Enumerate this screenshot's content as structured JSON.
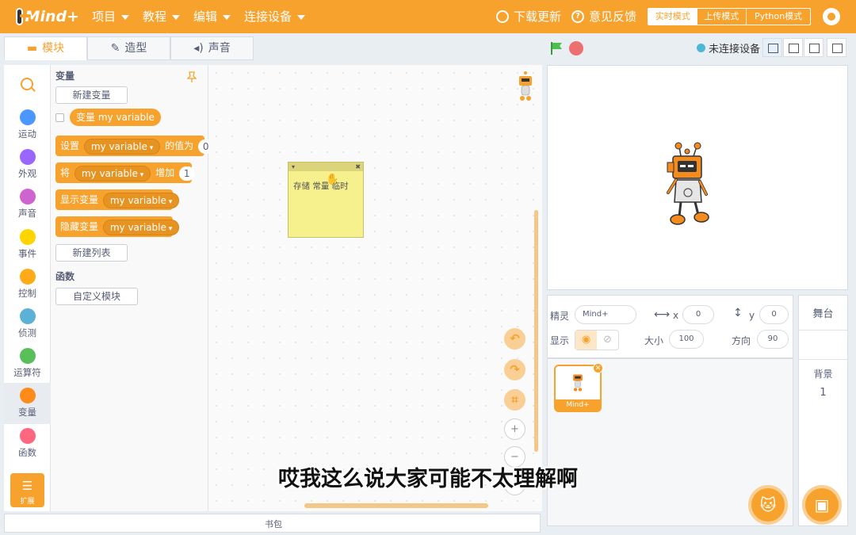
{
  "topbar": {
    "logo_text": "Mind+",
    "menus": [
      {
        "label": "项目"
      },
      {
        "label": "教程"
      },
      {
        "label": "编辑"
      },
      {
        "label": "连接设备"
      }
    ],
    "download_update": "下载更新",
    "feedback": "意见反馈",
    "modes": {
      "realtime": "实时模式",
      "upload": "上传模式",
      "python": "Python模式"
    },
    "accent_color": "#f8a22e"
  },
  "tabs": [
    {
      "label": "模块",
      "icon": "blocks-icon"
    },
    {
      "label": "造型",
      "icon": "brush-icon"
    },
    {
      "label": "声音",
      "icon": "speaker-icon"
    }
  ],
  "stage_controls": {
    "connection_status": "未连接设备"
  },
  "categories": [
    {
      "label": "运动",
      "color": "#4c97ff"
    },
    {
      "label": "外观",
      "color": "#9966ff"
    },
    {
      "label": "声音",
      "color": "#cf63cf"
    },
    {
      "label": "事件",
      "color": "#ffd500"
    },
    {
      "label": "控制",
      "color": "#ffab19"
    },
    {
      "label": "侦测",
      "color": "#5cb1d6"
    },
    {
      "label": "运算符",
      "color": "#59c059"
    },
    {
      "label": "变量",
      "color": "#ff8c1a"
    },
    {
      "label": "函数",
      "color": "#ff6680"
    }
  ],
  "extension_label": "扩展",
  "palette": {
    "section_variables": "变量",
    "new_variable": "新建变量",
    "reporter": {
      "prefix": "变量",
      "name": "my variable"
    },
    "set_block": {
      "prefix": "设置",
      "var": "my variable",
      "suffix": "的值为",
      "value": "0"
    },
    "change_block": {
      "prefix": "将",
      "var": "my variable",
      "suffix": "增加",
      "value": "1"
    },
    "show_block": {
      "prefix": "显示变量",
      "var": "my variable"
    },
    "hide_block": {
      "prefix": "隐藏变量",
      "var": "my variable"
    },
    "new_list": "新建列表",
    "section_functions": "函数",
    "custom_block": "自定义模块"
  },
  "workspace": {
    "note_text": "存储 常量 临时",
    "note_collapse": "▾",
    "note_close": "✖"
  },
  "bottombar": {
    "label": "书包"
  },
  "sprite_info": {
    "sprite_label": "精灵",
    "sprite_name": "Mind+",
    "x_label": "x",
    "x_value": "0",
    "y_label": "y",
    "y_value": "0",
    "show_label": "显示",
    "size_label": "大小",
    "size_value": "100",
    "direction_label": "方向",
    "direction_value": "90"
  },
  "sprites": [
    {
      "name": "Mind+"
    }
  ],
  "stage_panel": {
    "title": "舞台",
    "backdrop_label": "背景",
    "backdrop_count": "1"
  },
  "subtitle": "哎我这么说大家可能不太理解啊"
}
